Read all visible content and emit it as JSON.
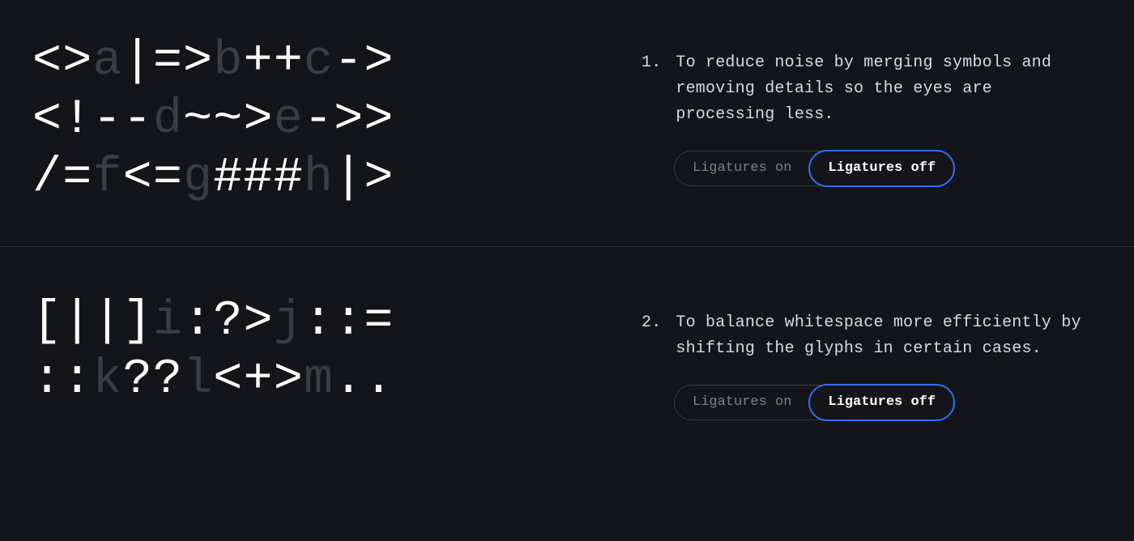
{
  "sections": [
    {
      "number": "1.",
      "description": "To reduce noise by merging symbols and removing details so the eyes are processing less.",
      "toggle": {
        "on_label": "Ligatures on",
        "off_label": "Ligatures off",
        "active": "off"
      },
      "specimen": [
        [
          {
            "t": "<>",
            "c": "sym"
          },
          {
            "t": "a",
            "c": "dim"
          },
          {
            "t": "|=>",
            "c": "sym"
          },
          {
            "t": "b",
            "c": "dim"
          },
          {
            "t": "++",
            "c": "sym"
          },
          {
            "t": "c",
            "c": "dim"
          },
          {
            "t": "->",
            "c": "sym"
          }
        ],
        [
          {
            "t": "<!--",
            "c": "sym"
          },
          {
            "t": "d",
            "c": "dim"
          },
          {
            "t": "~~>",
            "c": "sym"
          },
          {
            "t": "e",
            "c": "dim"
          },
          {
            "t": "->>",
            "c": "sym"
          }
        ],
        [
          {
            "t": "/=",
            "c": "sym"
          },
          {
            "t": "f",
            "c": "dim"
          },
          {
            "t": "<=",
            "c": "sym"
          },
          {
            "t": "g",
            "c": "dim"
          },
          {
            "t": "###",
            "c": "sym"
          },
          {
            "t": "h",
            "c": "dim"
          },
          {
            "t": "|>",
            "c": "sym"
          }
        ]
      ]
    },
    {
      "number": "2.",
      "description": "To balance whitespace more efficiently by shifting the glyphs in certain cases.",
      "toggle": {
        "on_label": "Ligatures on",
        "off_label": "Ligatures off",
        "active": "off"
      },
      "specimen": [
        [
          {
            "t": "[||]",
            "c": "sym"
          },
          {
            "t": "i",
            "c": "dim"
          },
          {
            "t": ":?>",
            "c": "sym"
          },
          {
            "t": "j",
            "c": "dim"
          },
          {
            "t": "::=",
            "c": "sym"
          }
        ],
        [
          {
            "t": "::",
            "c": "sym"
          },
          {
            "t": "k",
            "c": "dim"
          },
          {
            "t": "??",
            "c": "sym"
          },
          {
            "t": "l",
            "c": "dim"
          },
          {
            "t": "<+>",
            "c": "sym"
          },
          {
            "t": "m",
            "c": "dim"
          },
          {
            "t": "..",
            "c": "sym"
          }
        ]
      ]
    }
  ]
}
